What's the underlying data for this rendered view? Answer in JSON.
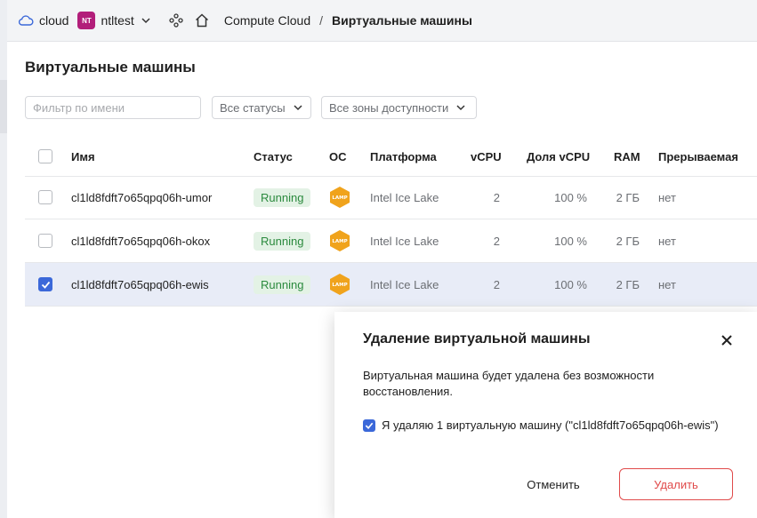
{
  "topbar": {
    "cloud_icon": "cloud-icon",
    "cloud_label": "cloud",
    "folder_badge": "NT",
    "folder_name": "ntltest",
    "breadcrumb_service": "Compute Cloud",
    "breadcrumb_separator": "/",
    "breadcrumb_page": "Виртуальные машины"
  },
  "page": {
    "title": "Виртуальные машины"
  },
  "filters": {
    "name_placeholder": "Фильтр по имени",
    "status_select": "Все статусы",
    "zone_select": "Все зоны доступности"
  },
  "table": {
    "headers": {
      "name": "Имя",
      "status": "Статус",
      "os": "ОС",
      "platform": "Платформа",
      "vcpu": "vCPU",
      "vcpu_share": "Доля vCPU",
      "ram": "RAM",
      "preemptible": "Прерываемая"
    },
    "rows": [
      {
        "name": "cl1ld8fdft7o65qpq06h-umor",
        "status": "Running",
        "os_badge": "LAMP",
        "platform": "Intel Ice Lake",
        "vcpu": "2",
        "vcpu_share": "100 %",
        "ram": "2 ГБ",
        "preemptible": "нет",
        "selected": false
      },
      {
        "name": "cl1ld8fdft7o65qpq06h-okox",
        "status": "Running",
        "os_badge": "LAMP",
        "platform": "Intel Ice Lake",
        "vcpu": "2",
        "vcpu_share": "100 %",
        "ram": "2 ГБ",
        "preemptible": "нет",
        "selected": false
      },
      {
        "name": "cl1ld8fdft7o65qpq06h-ewis",
        "status": "Running",
        "os_badge": "LAMP",
        "platform": "Intel Ice Lake",
        "vcpu": "2",
        "vcpu_share": "100 %",
        "ram": "2 ГБ",
        "preemptible": "нет",
        "selected": true
      }
    ]
  },
  "dialog": {
    "title": "Удаление виртуальной машины",
    "message": "Виртуальная машина будет удалена без возможности восстановления.",
    "confirm_checkbox_label": "Я удаляю 1 виртуальную машину (\"cl1ld8fdft7o65qpq06h-ewis\")",
    "confirm_checked": true,
    "cancel_label": "Отменить",
    "delete_label": "Удалить"
  },
  "colors": {
    "accent_blue": "#3b68d9",
    "danger_red": "#e04a4a",
    "running_green": "#2b8a3e",
    "folder_badge": "#b21e7a",
    "lamp_orange": "#f0a31c"
  }
}
